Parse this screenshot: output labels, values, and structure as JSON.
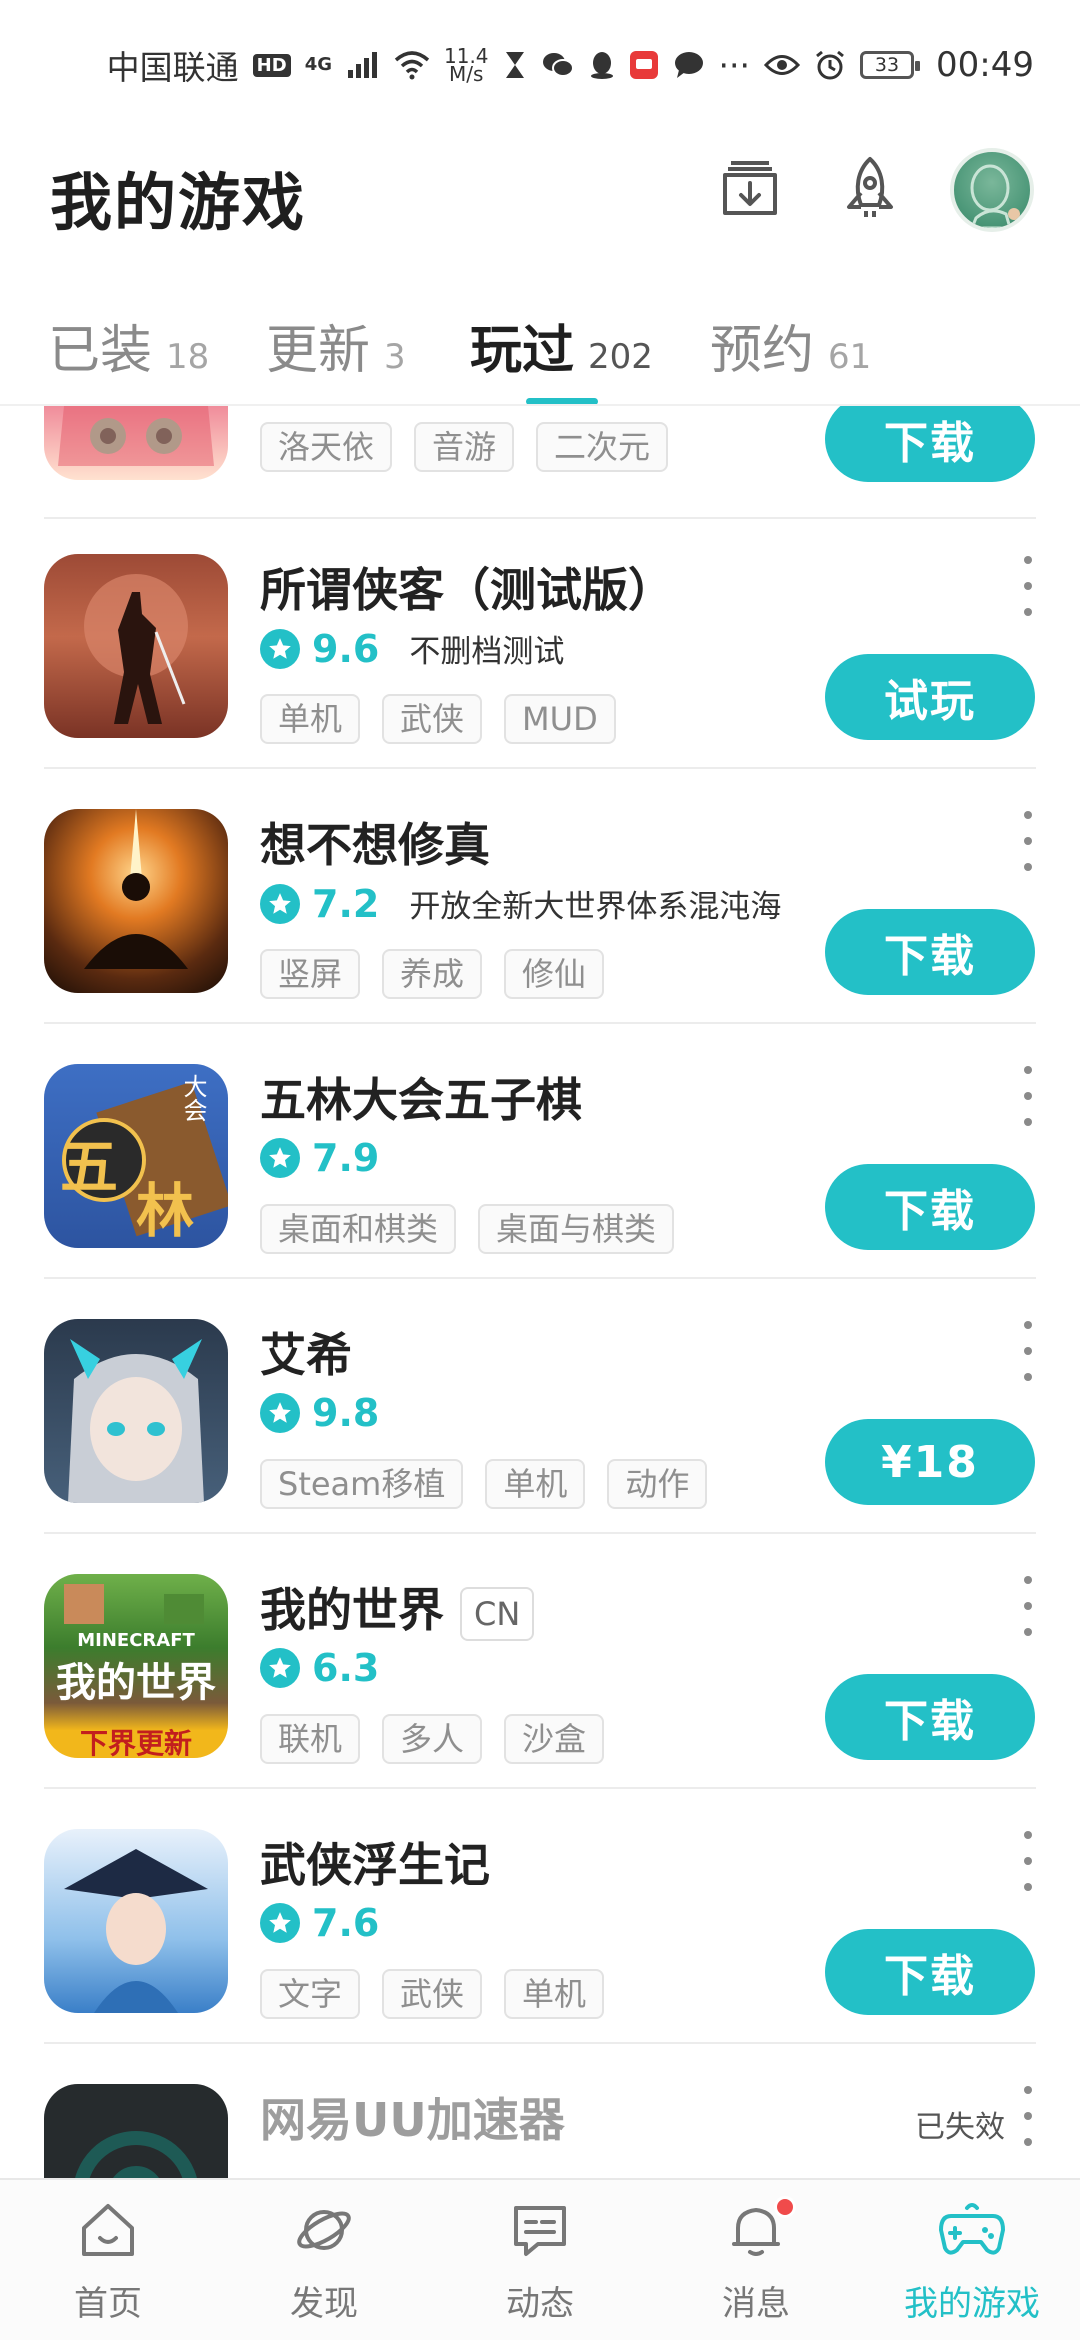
{
  "status_bar": {
    "carrier": "中国联通",
    "hd": "HD",
    "network_type": "4G",
    "speed_value": "11.4",
    "speed_unit": "M/s",
    "more": "···",
    "battery": "33",
    "time": "00:49"
  },
  "header": {
    "title": "我的游戏"
  },
  "tabs": [
    {
      "label": "已装",
      "count": "18"
    },
    {
      "label": "更新",
      "count": "3"
    },
    {
      "label": "玩过",
      "count": "202"
    },
    {
      "label": "预约",
      "count": "61"
    }
  ],
  "games": [
    {
      "name": "",
      "tags": [
        "洛天依",
        "音游",
        "二次元"
      ],
      "action": "下载"
    },
    {
      "name": "所谓侠客（测试版）",
      "rating": "9.6",
      "note": "不删档测试",
      "tags": [
        "单机",
        "武侠",
        "MUD"
      ],
      "action": "试玩"
    },
    {
      "name": "想不想修真",
      "rating": "7.2",
      "note": "开放全新大世界体系混沌海",
      "tags": [
        "竖屏",
        "养成",
        "修仙"
      ],
      "action": "下载"
    },
    {
      "name": "五林大会五子棋",
      "rating": "7.9",
      "tags": [
        "桌面和棋类",
        "桌面与棋类"
      ],
      "action": "下载"
    },
    {
      "name": "艾希",
      "rating": "9.8",
      "tags": [
        "Steam移植",
        "单机",
        "动作"
      ],
      "action": "¥18"
    },
    {
      "name": "我的世界",
      "badge": "CN",
      "rating": "6.3",
      "tags": [
        "联机",
        "多人",
        "沙盒"
      ],
      "action": "下载"
    },
    {
      "name": "武侠浮生记",
      "rating": "7.6",
      "tags": [
        "文字",
        "武侠",
        "单机"
      ],
      "action": "下载"
    },
    {
      "name": "网易UU加速器",
      "status": "已失效"
    }
  ],
  "icon_text": {
    "wulin_big": "五",
    "wulin_small": "林",
    "wulin_corner": "大会",
    "mc_top": "MINECRAFT",
    "mc_main": "我的世界",
    "mc_bottom": "下界更新"
  },
  "bottom_nav": [
    {
      "label": "首页",
      "icon": "home-icon"
    },
    {
      "label": "发现",
      "icon": "planet-icon"
    },
    {
      "label": "动态",
      "icon": "message-icon"
    },
    {
      "label": "消息",
      "icon": "bell-icon"
    },
    {
      "label": "我的游戏",
      "icon": "gamepad-icon"
    }
  ],
  "colors": {
    "accent": "#23c0c7",
    "notification": "#f04b4b"
  }
}
